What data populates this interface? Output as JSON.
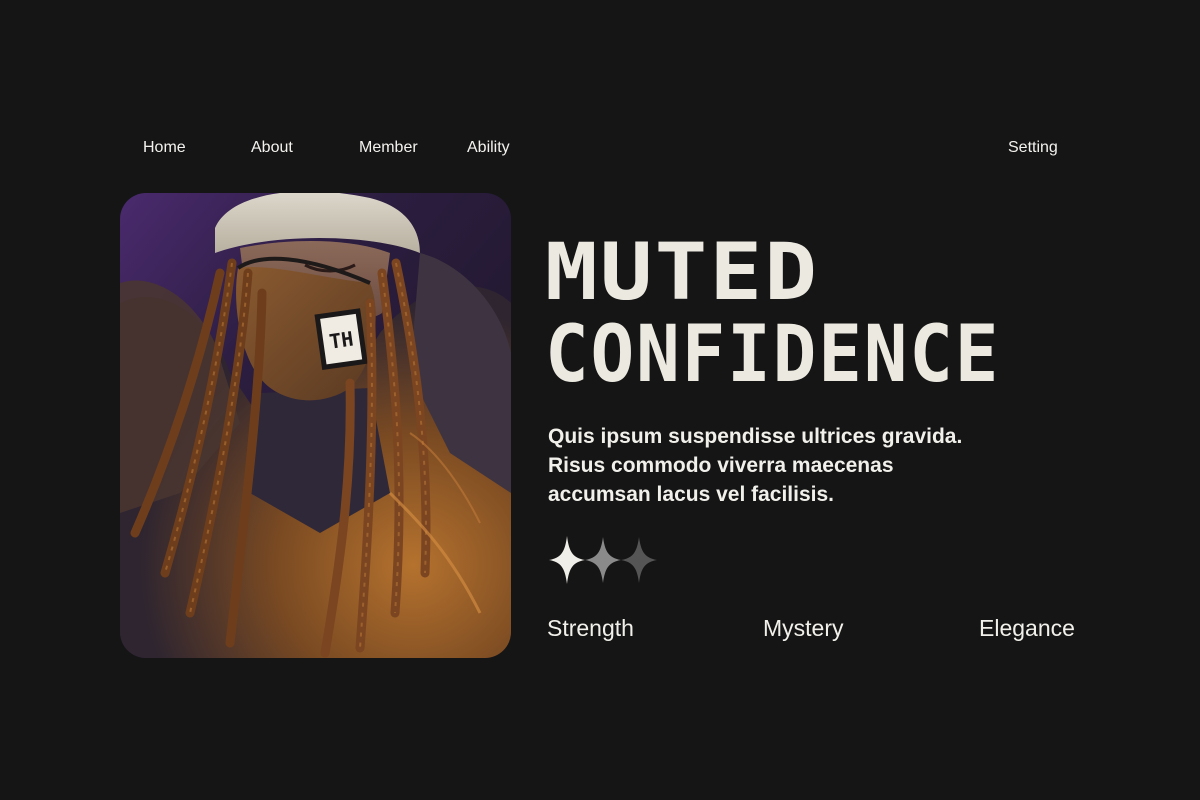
{
  "nav": {
    "home": "Home",
    "about": "About",
    "member": "Member",
    "ability": "Ability",
    "setting": "Setting"
  },
  "hero": {
    "title_line1": "MUTED",
    "title_line2": "CONFIDENCE",
    "description": "Quis ipsum suspendisse ultrices gravida. Risus commodo viverra maecenas accumsan lacus vel facilisis.",
    "rating": {
      "filled": 1,
      "total": 3
    }
  },
  "traits": [
    "Strength",
    "Mystery",
    "Elegance"
  ],
  "photo": {
    "mask_logo": "TH",
    "subject": "person-in-mask-photo"
  },
  "colors": {
    "background": "#151515",
    "text": "#f2f0ea",
    "star_filled": "#f0eee8",
    "star_mid": "#8a8a8a",
    "star_dim": "#555555"
  }
}
